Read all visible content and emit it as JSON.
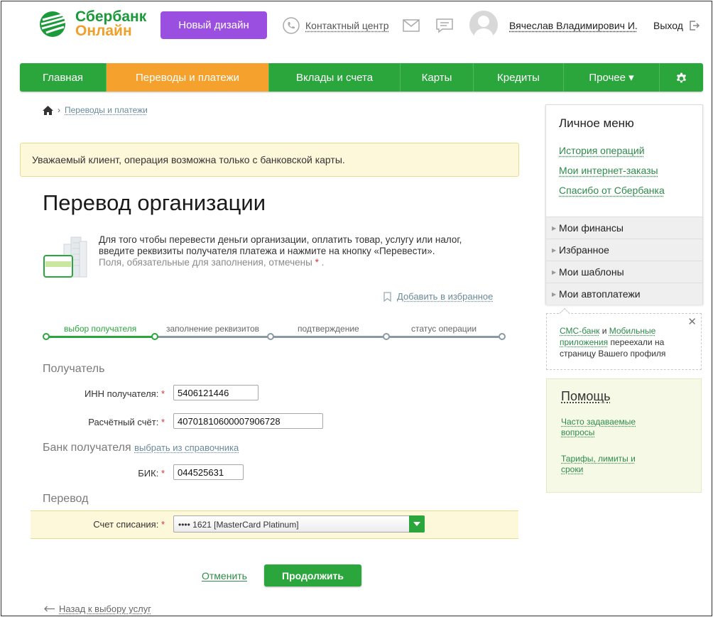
{
  "header": {
    "logo_line1": "Сбербанк",
    "logo_line2": "Онлайн",
    "new_design_label": "Новый дизайн",
    "contact_center_label": "Контактный центр",
    "user_name": "Вячеслав Владимирович И.",
    "logout_label": "Выход"
  },
  "nav": {
    "items": [
      {
        "label": "Главная",
        "active": false
      },
      {
        "label": "Переводы и платежи",
        "active": true
      },
      {
        "label": "Вклады и счета",
        "active": false
      },
      {
        "label": "Карты",
        "active": false
      },
      {
        "label": "Кредиты",
        "active": false
      },
      {
        "label": "Прочее ▾",
        "active": false
      }
    ]
  },
  "breadcrumb": {
    "current": "Переводы и платежи"
  },
  "notice": "Уважаемый клиент, операция возможна только с банковской карты.",
  "page": {
    "title": "Перевод организации",
    "intro_text": "Для того чтобы перевести деньги организации, оплатить товар, услугу или налог, введите реквизиты получателя платежа и нажмите на кнопку «Перевести».",
    "required_hint": "Поля, обязательные для заполнения, отмечены",
    "required_mark": "*",
    "add_favorite": "Добавить в избранное"
  },
  "steps": [
    {
      "label": "выбор получателя",
      "active": true
    },
    {
      "label": "заполнение реквизитов",
      "active": false
    },
    {
      "label": "подтверждение",
      "active": false
    },
    {
      "label": "статус операции",
      "active": false
    }
  ],
  "form": {
    "recipient_section": "Получатель",
    "inn_label": "ИНН получателя:",
    "inn_value": "5406121446",
    "account_label": "Расчётный счёт:",
    "account_value": "40701810600007906728",
    "bank_section": "Банк получателя",
    "pick_from_directory": "выбрать из справочника",
    "bik_label": "БИК:",
    "bik_value": "044525631",
    "transfer_section": "Перевод",
    "debit_label": "Счет списания:",
    "debit_value": "•••• 1621 [MasterCard Platinum]",
    "required_mark": "*"
  },
  "actions": {
    "cancel": "Отменить",
    "continue": "Продолжить",
    "back": "Назад к выбору услуг"
  },
  "sidebar": {
    "personal_menu_title": "Личное меню",
    "links": [
      "История операций",
      "Мои интернет-заказы",
      "Спасибо от Сбербанка"
    ],
    "sections": [
      "Мои финансы",
      "Избранное",
      "Мои шаблоны",
      "Мои автоплатежи"
    ],
    "sms_notice": {
      "sms_bank": "СМС-банк",
      "and": "и",
      "mobile_apps": "Мобильные приложения",
      "rest": "переехали на страницу Вашего профиля"
    },
    "help": {
      "title": "Помощь",
      "faq": "Часто задаваемые вопросы",
      "tariffs": "Тарифы, лимиты и сроки"
    }
  },
  "colors": {
    "brand_green": "#2aa63d",
    "active_tab_orange": "#f5a12d",
    "new_design_purple": "#9b4fe0",
    "notice_yellow": "#fcf8d9"
  }
}
